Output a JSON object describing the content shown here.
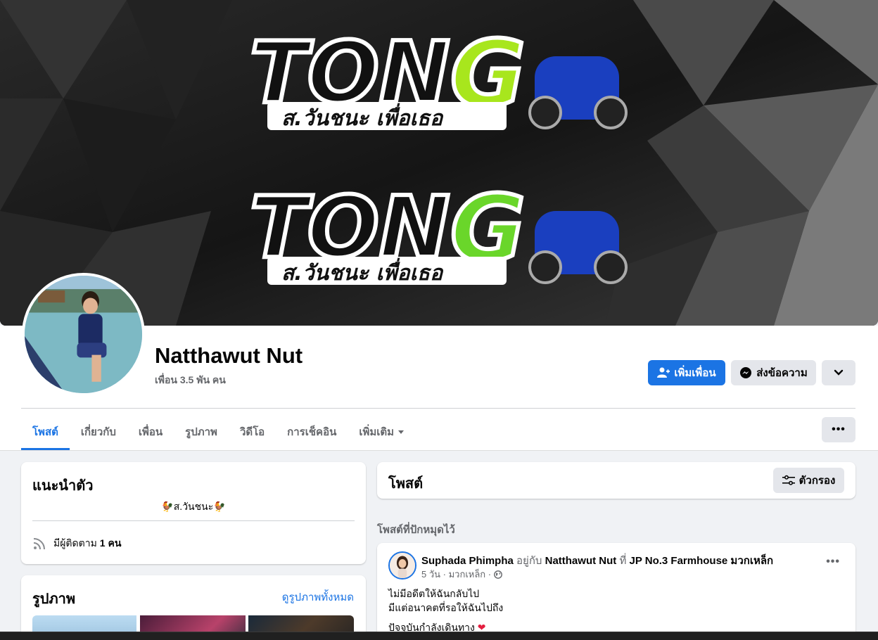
{
  "cover": {
    "logo_text": "TONG",
    "slogan": "ส.วันชนะ เพื่อเธอ"
  },
  "profile": {
    "name": "Natthawut Nut",
    "friends": "เพื่อน 3.5 พัน คน"
  },
  "actions": {
    "add_friend": "เพิ่มเพื่อน",
    "message": "ส่งข้อความ"
  },
  "tabs": [
    {
      "label": "โพสต์"
    },
    {
      "label": "เกี่ยวกับ"
    },
    {
      "label": "เพื่อน"
    },
    {
      "label": "รูปภาพ"
    },
    {
      "label": "วิดีโอ"
    },
    {
      "label": "การเช็คอิน"
    },
    {
      "label": "เพิ่มเติม"
    }
  ],
  "intro": {
    "title": "แนะนำตัว",
    "bio": "🐓ส.วันชนะ🐓",
    "followers_prefix": "มีผู้ติดตาม",
    "followers_count": "1 คน"
  },
  "photos": {
    "title": "รูปภาพ",
    "see_all": "ดูรูปภาพทั้งหมด"
  },
  "posts": {
    "title": "โพสต์",
    "filter": "ตัวกรอง",
    "pinned_label": "โพสต์ที่ปักหมุดไว้"
  },
  "post": {
    "author": "Suphada Phimpha",
    "with_text": "อยู่กับ",
    "tagged": "Natthawut Nut",
    "at_text": "ที่",
    "place": "JP No.3 Farmhouse มวกเหล็ก",
    "meta": "5 วัน · มวกเหล็ก ·",
    "line1": "ไม่มีอดีตให้ฉันกลับไป",
    "line2": "มีแต่อนาคตที่รอให้ฉันไปถึง",
    "line3": "ปัจจุบันกำลังเดินทาง"
  }
}
